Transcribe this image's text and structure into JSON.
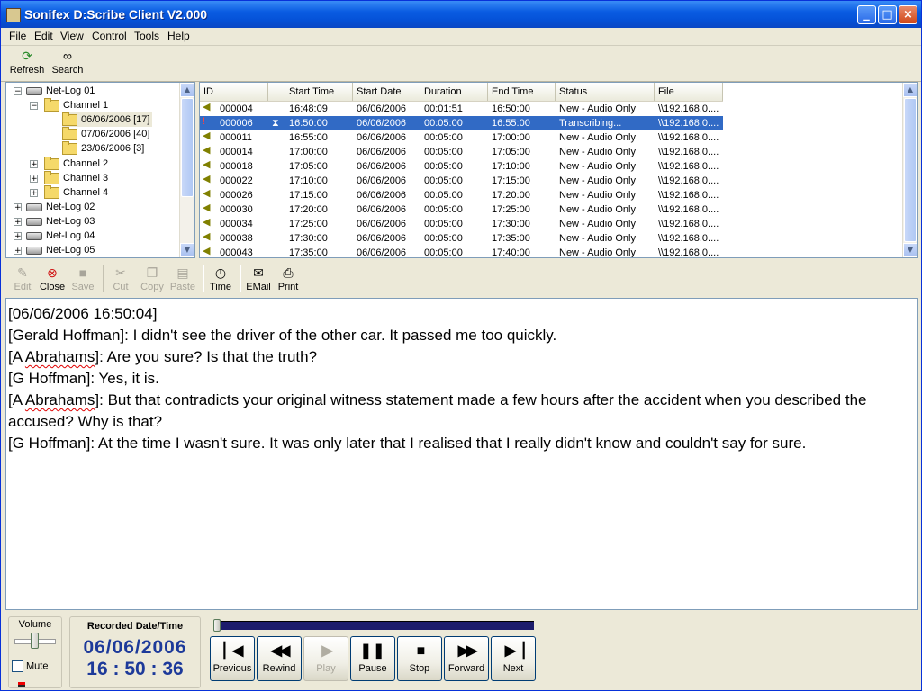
{
  "window": {
    "title": "Sonifex D:Scribe Client V2.000",
    "minimize": "_",
    "maximize": "□",
    "close": "×"
  },
  "menu": [
    "File",
    "Edit",
    "View",
    "Control",
    "Tools",
    "Help"
  ],
  "toolbar": {
    "refresh": "Refresh",
    "search": "Search"
  },
  "tree": {
    "netlog01": "Net-Log 01",
    "channel1": "Channel 1",
    "dates": [
      "06/06/2006  [17]",
      "07/06/2006  [40]",
      "23/06/2006  [3]"
    ],
    "channel2": "Channel 2",
    "channel3": "Channel 3",
    "channel4": "Channel 4",
    "netlog02": "Net-Log 02",
    "netlog03": "Net-Log 03",
    "netlog04": "Net-Log 04",
    "netlog05": "Net-Log 05"
  },
  "list": {
    "columns": [
      "ID",
      "",
      "Start Time",
      "Start Date",
      "Duration",
      "End Time",
      "Status",
      "File"
    ],
    "rows": [
      {
        "id": "000004",
        "start_time": "16:48:09",
        "start_date": "06/06/2006",
        "duration": "00:01:51",
        "end_time": "16:50:00",
        "status": "New - Audio Only",
        "file": "\\\\192.168.0...."
      },
      {
        "id": "000006",
        "start_time": "16:50:00",
        "start_date": "06/06/2006",
        "duration": "00:05:00",
        "end_time": "16:55:00",
        "status": "Transcribing...",
        "file": "\\\\192.168.0...."
      },
      {
        "id": "000011",
        "start_time": "16:55:00",
        "start_date": "06/06/2006",
        "duration": "00:05:00",
        "end_time": "17:00:00",
        "status": "New - Audio Only",
        "file": "\\\\192.168.0...."
      },
      {
        "id": "000014",
        "start_time": "17:00:00",
        "start_date": "06/06/2006",
        "duration": "00:05:00",
        "end_time": "17:05:00",
        "status": "New - Audio Only",
        "file": "\\\\192.168.0...."
      },
      {
        "id": "000018",
        "start_time": "17:05:00",
        "start_date": "06/06/2006",
        "duration": "00:05:00",
        "end_time": "17:10:00",
        "status": "New - Audio Only",
        "file": "\\\\192.168.0...."
      },
      {
        "id": "000022",
        "start_time": "17:10:00",
        "start_date": "06/06/2006",
        "duration": "00:05:00",
        "end_time": "17:15:00",
        "status": "New - Audio Only",
        "file": "\\\\192.168.0...."
      },
      {
        "id": "000026",
        "start_time": "17:15:00",
        "start_date": "06/06/2006",
        "duration": "00:05:00",
        "end_time": "17:20:00",
        "status": "New - Audio Only",
        "file": "\\\\192.168.0...."
      },
      {
        "id": "000030",
        "start_time": "17:20:00",
        "start_date": "06/06/2006",
        "duration": "00:05:00",
        "end_time": "17:25:00",
        "status": "New - Audio Only",
        "file": "\\\\192.168.0...."
      },
      {
        "id": "000034",
        "start_time": "17:25:00",
        "start_date": "06/06/2006",
        "duration": "00:05:00",
        "end_time": "17:30:00",
        "status": "New - Audio Only",
        "file": "\\\\192.168.0...."
      },
      {
        "id": "000038",
        "start_time": "17:30:00",
        "start_date": "06/06/2006",
        "duration": "00:05:00",
        "end_time": "17:35:00",
        "status": "New - Audio Only",
        "file": "\\\\192.168.0...."
      },
      {
        "id": "000043",
        "start_time": "17:35:00",
        "start_date": "06/06/2006",
        "duration": "00:05:00",
        "end_time": "17:40:00",
        "status": "New - Audio Only",
        "file": "\\\\192.168.0...."
      }
    ]
  },
  "editor_toolbar": {
    "edit": "Edit",
    "close": "Close",
    "save": "Save",
    "cut": "Cut",
    "copy": "Copy",
    "paste": "Paste",
    "time": "Time",
    "email": "EMail",
    "print": "Print"
  },
  "transcript": {
    "line1": "[06/06/2006  16:50:04]",
    "line2": "[Gerald Hoffman]: I didn't see the driver of the other car.  It passed me too quickly.",
    "line3_a": "[A ",
    "line3_b": "Abrahams",
    "line3_c": "]: Are you sure? Is that the truth?",
    "line4": "[G Hoffman]: Yes, it is.",
    "line5_a": "[A ",
    "line5_b": "Abrahams",
    "line5_c": "]: But that contradicts your original witness statement made a few hours after the accident when you described the accused? Why is that?",
    "line6": "[G Hoffman]: At the time I wasn't sure. It was only later that I realised that I really didn't know and couldn't say for sure."
  },
  "player": {
    "volume_label": "Volume",
    "volume_level": 0.5,
    "mute_label": "Mute",
    "recorded_label": "Recorded Date/Time",
    "date": "06/06/2006",
    "time": "16 : 50 : 36",
    "progress": 0.0,
    "buttons": [
      "Previous",
      "Rewind",
      "Play",
      "Pause",
      "Stop",
      "Forward",
      "Next"
    ]
  },
  "colors": {
    "title_blue": "#0a5ce2",
    "selection": "#316ac5",
    "clock_blue": "#1d3a9a",
    "progress_track": "#1c1c6c"
  }
}
